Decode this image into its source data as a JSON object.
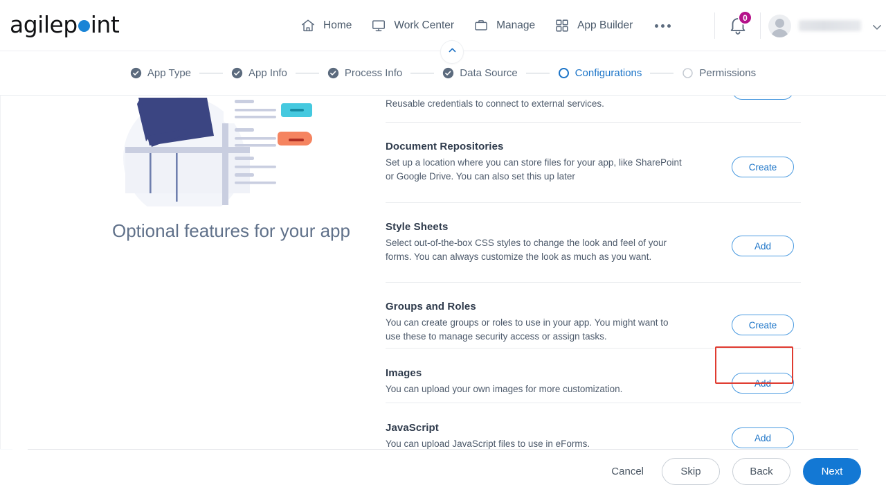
{
  "brand": {
    "name_part1": "agilep",
    "name_part2": "int",
    "dot_color": "#1a84d6"
  },
  "topnav": {
    "items": [
      {
        "label": "Home",
        "icon": "home-icon"
      },
      {
        "label": "Work Center",
        "icon": "monitor-icon"
      },
      {
        "label": "Manage",
        "icon": "briefcase-icon"
      },
      {
        "label": "App Builder",
        "icon": "grid-icon"
      }
    ],
    "overflow_label": "more-options",
    "notification_count": "0",
    "user_name": ""
  },
  "stepper": {
    "steps": [
      {
        "label": "App Type",
        "state": "complete"
      },
      {
        "label": "App Info",
        "state": "complete"
      },
      {
        "label": "Process Info",
        "state": "complete"
      },
      {
        "label": "Data Source",
        "state": "complete"
      },
      {
        "label": "Configurations",
        "state": "current"
      },
      {
        "label": "Permissions",
        "state": "upcoming"
      }
    ],
    "accent_current": "#1a73c7",
    "accent_complete": "#59687a"
  },
  "hero": {
    "title": "Optional features for your app"
  },
  "options": [
    {
      "title": "",
      "desc": "Reusable credentials to connect to external services.",
      "button": "",
      "partial": true
    },
    {
      "title": "Document Repositories",
      "desc": "Set up a location where you can store files for your app, like SharePoint or Google Drive. You can also set this up later",
      "button": "Create",
      "partial": false
    },
    {
      "title": "Style Sheets",
      "desc": "Select out-of-the-box CSS styles to change the look and feel of your forms. You can always customize the look as much as you want.",
      "button": "Add",
      "partial": false
    },
    {
      "title": "Groups and Roles",
      "desc": "You can create groups or roles to use in your app. You might want to use these to manage security access or assign tasks.",
      "button": "Create",
      "partial": false
    },
    {
      "title": "Images",
      "desc": "You can upload your own images for more customization.",
      "button": "Add",
      "partial": false,
      "highlighted": true
    },
    {
      "title": "JavaScript",
      "desc": "You can upload JavaScript files to use in eForms.",
      "button": "Add",
      "partial": false
    }
  ],
  "footer": {
    "cancel": "Cancel",
    "skip": "Skip",
    "back": "Back",
    "next": "Next",
    "primary_color": "#1378d4"
  },
  "highlight": {
    "color": "#e03b30"
  }
}
